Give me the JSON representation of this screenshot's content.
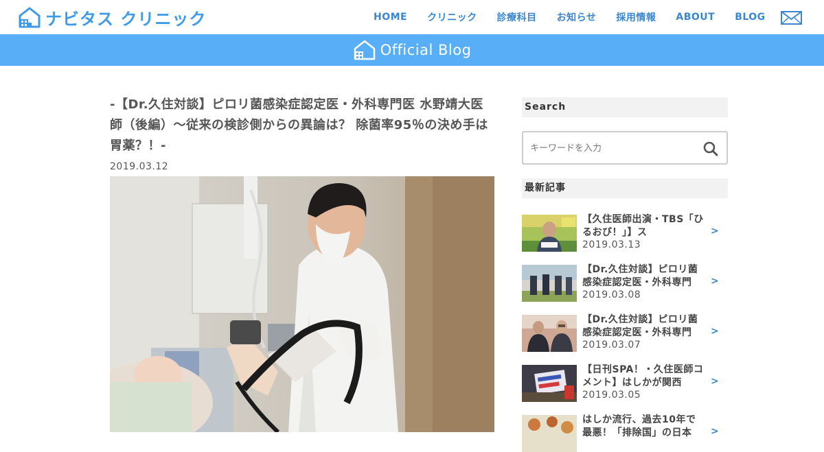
{
  "header": {
    "logo_text": "ナビタス クリニック",
    "nav": [
      "HOME",
      "クリニック",
      "診療科目",
      "お知らせ",
      "採用情報",
      "ABOUT",
      "BLOG"
    ],
    "mail_icon": "envelope-icon"
  },
  "banner": {
    "text": "Official Blog"
  },
  "article": {
    "title": "-【Dr.久住対談】ピロリ菌感染症認定医・外科専門医 水野靖大医師（後編）～従来の検診側からの異論は？ 除菌率95％の決め手は胃薬？！-",
    "date": "2019.03.12"
  },
  "sidebar": {
    "search_title": "Search",
    "search_placeholder": "キーワードを入力",
    "recent_title": "最新記事",
    "posts": [
      {
        "title": "【久住医師出演・TBS「ひるおび！」】ス",
        "date": "2019.03.13"
      },
      {
        "title": "【Dr.久住対談】ピロリ菌感染症認定医・外科専門",
        "date": "2019.03.08"
      },
      {
        "title": "【Dr.久住対談】ピロリ菌感染症認定医・外科専門",
        "date": "2019.03.07"
      },
      {
        "title": "【日刊SPA！・久住医師コメント】はしかが関西",
        "date": "2019.03.05"
      },
      {
        "title": "はしか流行、過去10年で最悪！「排除国」の日本",
        "date": ""
      }
    ],
    "arrow": ">"
  },
  "colors": {
    "accent": "#3a86d0",
    "banner": "#58aff7",
    "logo": "#3e9be8"
  }
}
